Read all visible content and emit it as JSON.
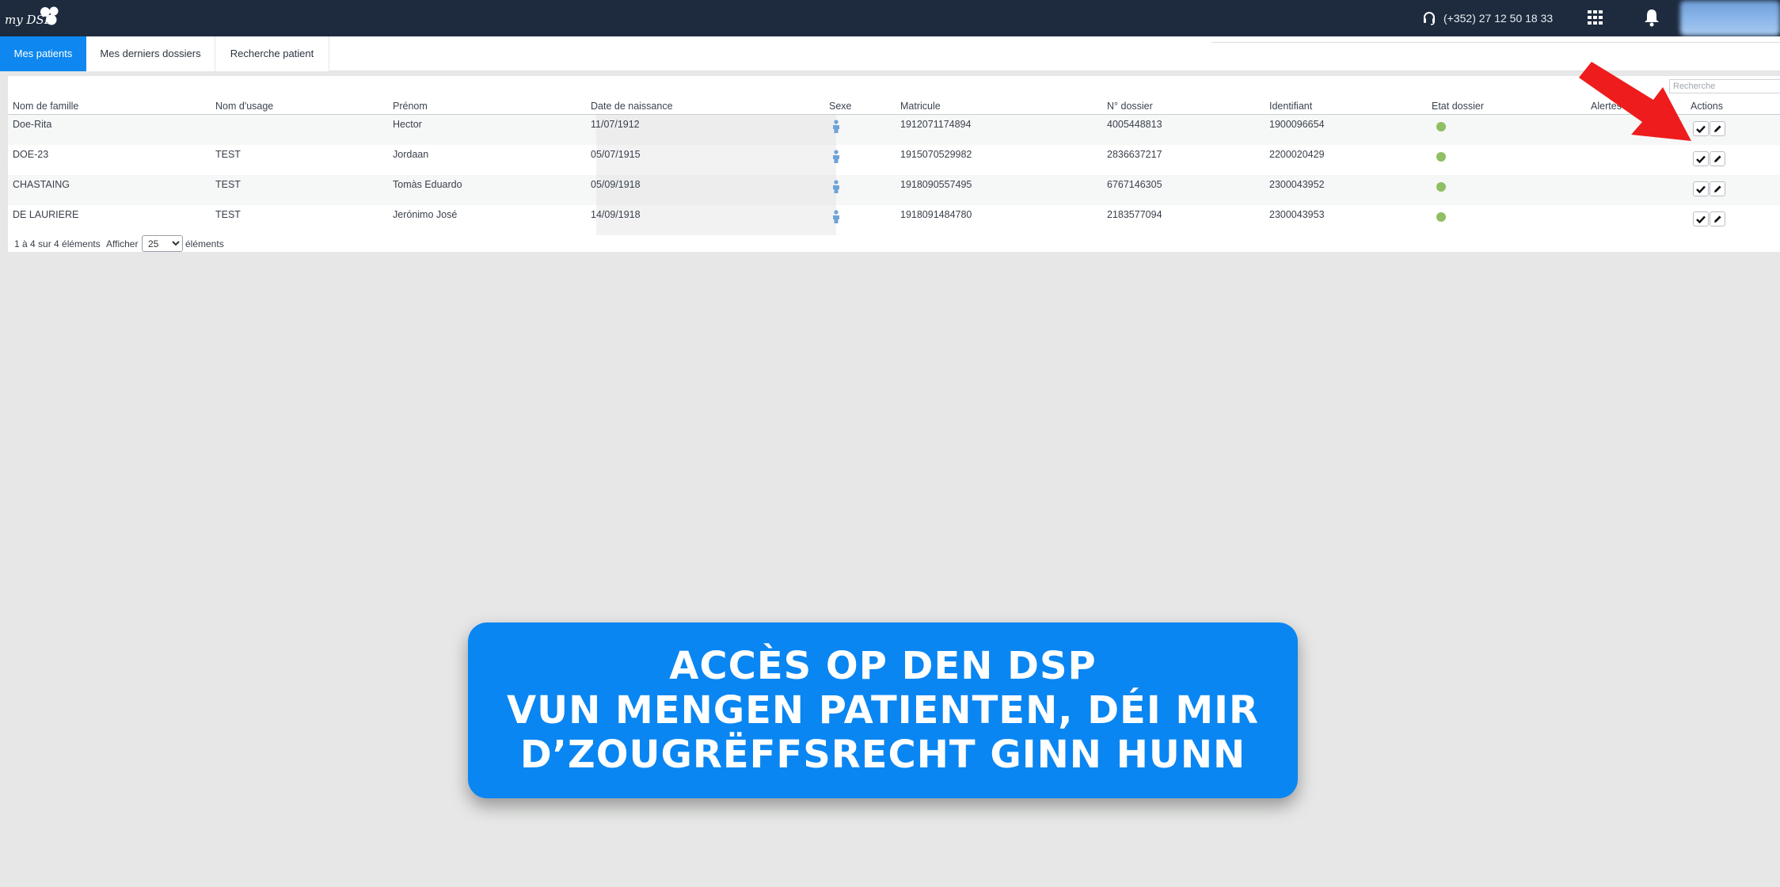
{
  "header": {
    "logo_text": "my DSP",
    "phone": "(+352) 27 12 50 18 33",
    "icons": {
      "phone": "headset-icon",
      "apps": "grid-icon",
      "notifications": "bell-icon"
    }
  },
  "tabs": [
    {
      "label": "Mes patients",
      "active": true
    },
    {
      "label": "Mes derniers dossiers",
      "active": false
    },
    {
      "label": "Recherche patient",
      "active": false
    }
  ],
  "search": {
    "placeholder": "Recherche"
  },
  "table": {
    "columns": [
      "Nom de famille",
      "Nom d'usage",
      "Prénom",
      "Date de naissance",
      "Sexe",
      "Matricule",
      "N° dossier",
      "Identifiant",
      "Etat dossier",
      "Alertes",
      "Actions"
    ],
    "rows": [
      {
        "nom": "Doe-Rita",
        "usage": "",
        "prenom": "Hector",
        "naissance": "11/07/1912",
        "sexe": "male-icon",
        "matricule": "1912071174894",
        "dossier": "4005448813",
        "identifiant": "1900096654",
        "etat": "green"
      },
      {
        "nom": "DOE-23",
        "usage": "TEST",
        "prenom": "Jordaan",
        "naissance": "05/07/1915",
        "sexe": "male-icon",
        "matricule": "1915070529982",
        "dossier": "2836637217",
        "identifiant": "2200020429",
        "etat": "green"
      },
      {
        "nom": "CHASTAING",
        "usage": "TEST",
        "prenom": "Tomàs Eduardo",
        "naissance": "05/09/1918",
        "sexe": "male-icon",
        "matricule": "1918090557495",
        "dossier": "6767146305",
        "identifiant": "2300043952",
        "etat": "green"
      },
      {
        "nom": "DE LAURIERE",
        "usage": "TEST",
        "prenom": "Jerónimo José",
        "naissance": "14/09/1918",
        "sexe": "male-icon",
        "matricule": "1918091484780",
        "dossier": "2183577094",
        "identifiant": "2300043953",
        "etat": "green"
      }
    ],
    "info": "1 à 4 sur 4 éléments",
    "page_size_label": "Afficher",
    "page_size": "25",
    "page_size_suffix": "éléments"
  },
  "caption": {
    "line1": "ACCÈS OP DEN DSP",
    "line2": "VUN MENGEN PATIENTEN, DÉI MIR",
    "line3": "D’ZOUGRËFFSRECHT GINN HUNN"
  },
  "colors": {
    "topbar": "#1e2b3e",
    "accent": "#0e88f0",
    "caption_bg": "#0a86f2",
    "status_ok": "#8fbf62",
    "arrow": "#ee1c1c"
  }
}
